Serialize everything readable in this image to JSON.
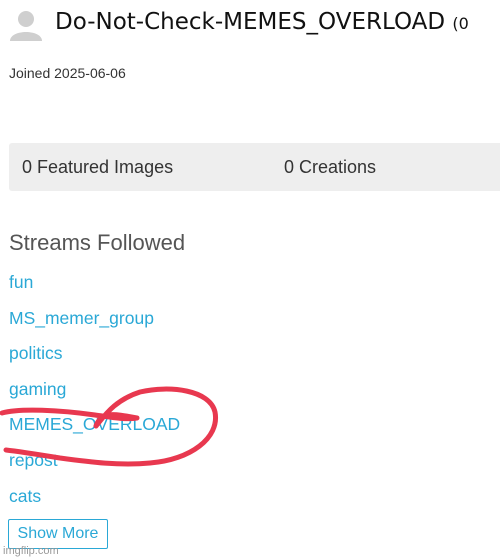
{
  "profile": {
    "username": "Do-Not-Check-MEMES_OVERLOAD",
    "points_fragment": "(0",
    "joined": "Joined 2025-06-06",
    "avatar_icon": "user-silhouette-icon"
  },
  "stats": {
    "featured_images": "0 Featured Images",
    "creations": "0 Creations"
  },
  "streams": {
    "title": "Streams Followed",
    "items": [
      {
        "label": "fun"
      },
      {
        "label": "MS_memer_group"
      },
      {
        "label": "politics"
      },
      {
        "label": "gaming"
      },
      {
        "label": "MEMES_OVERLOAD"
      },
      {
        "label": "repost"
      },
      {
        "label": "cats"
      }
    ],
    "show_more": "Show More"
  },
  "annotation": {
    "color": "#e8384f",
    "highlighted_stream": "MEMES_OVERLOAD"
  },
  "watermark": "imgflip.com",
  "colors": {
    "link": "#2aa8d6",
    "stats_bg": "#eeeeee"
  }
}
